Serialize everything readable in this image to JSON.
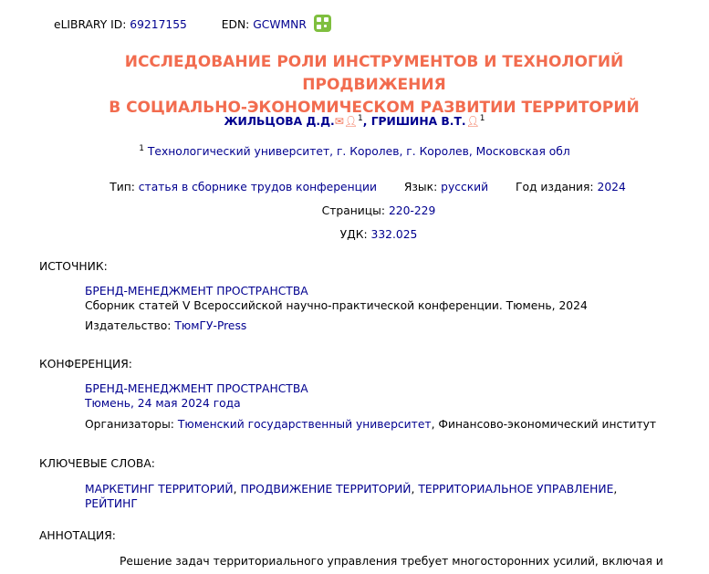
{
  "ids": {
    "elibrary_label": "eLIBRARY ID:",
    "elibrary_value": "69217155",
    "edn_label": "EDN:",
    "edn_value": "GCWMNR",
    "qr_icon": "qr-code-icon"
  },
  "title": {
    "line1": "ИССЛЕДОВАНИЕ РОЛИ ИНСТРУМЕНТОВ И ТЕХНОЛОГИЙ ПРОДВИЖЕНИЯ",
    "line2": "В СОЦИАЛЬНО-ЭКОНОМИЧЕСКОМ РАЗВИТИИ ТЕРРИТОРИЙ",
    "color": "#f26c4f"
  },
  "authors": [
    {
      "name": "ЖИЛЬЦОВА Д.Д.",
      "icons": [
        "mail-icon",
        "person-icon"
      ],
      "sup": "1"
    },
    {
      "name": "ГРИШИНА В.Т.",
      "icons": [
        "person-icon"
      ],
      "sup": "1"
    }
  ],
  "author_separator": ",",
  "affiliation": {
    "sup": "1",
    "text": "Технологический университет, г. Королев, г. Королев, Московская обл"
  },
  "meta": {
    "type_label": "Тип:",
    "type_value": "статья в сборнике трудов конференции",
    "lang_label": "Язык:",
    "lang_value": "русский",
    "year_label": "Год издания:",
    "year_value": "2024",
    "pages_label": "Страницы:",
    "pages_value": "220-229",
    "udk_label": "УДК:",
    "udk_value": "332.025"
  },
  "source": {
    "heading": "ИСТОЧНИК:",
    "title": "БРЕНД-МЕНЕДЖМЕНТ ПРОСТРАНСТВА",
    "desc": "Сборник статей V Всероссийской научно-практической конференции. Тюмень, 2024",
    "publisher_label": "Издательство:",
    "publisher_value": "ТюмГУ-Press"
  },
  "conference": {
    "heading": "КОНФЕРЕНЦИЯ:",
    "title": "БРЕНД-МЕНЕДЖМЕНТ ПРОСТРАНСТВА",
    "date": "Тюмень, 24 мая 2024 года",
    "org_label": "Организаторы:",
    "org_value1": "Тюменский государственный университет",
    "org_sep": ", ",
    "org_value2": "Финансово-экономический институт"
  },
  "keywords": {
    "heading": "КЛЮЧЕВЫЕ СЛОВА:",
    "items": [
      "МАРКЕТИНГ ТЕРРИТОРИЙ",
      "ПРОДВИЖЕНИЕ ТЕРРИТОРИЙ",
      "ТЕРРИТОРИАЛЬНОЕ УПРАВЛЕНИЕ",
      "РЕЙТИНГ"
    ],
    "sep": ", "
  },
  "annotation": {
    "heading": "АННОТАЦИЯ:",
    "text": "Решение задач территориального управления требует многосторонних усилий, включая и"
  },
  "colors": {
    "link": "#00008f",
    "accent": "#f26c4f",
    "qr": "#7fbf3f"
  }
}
